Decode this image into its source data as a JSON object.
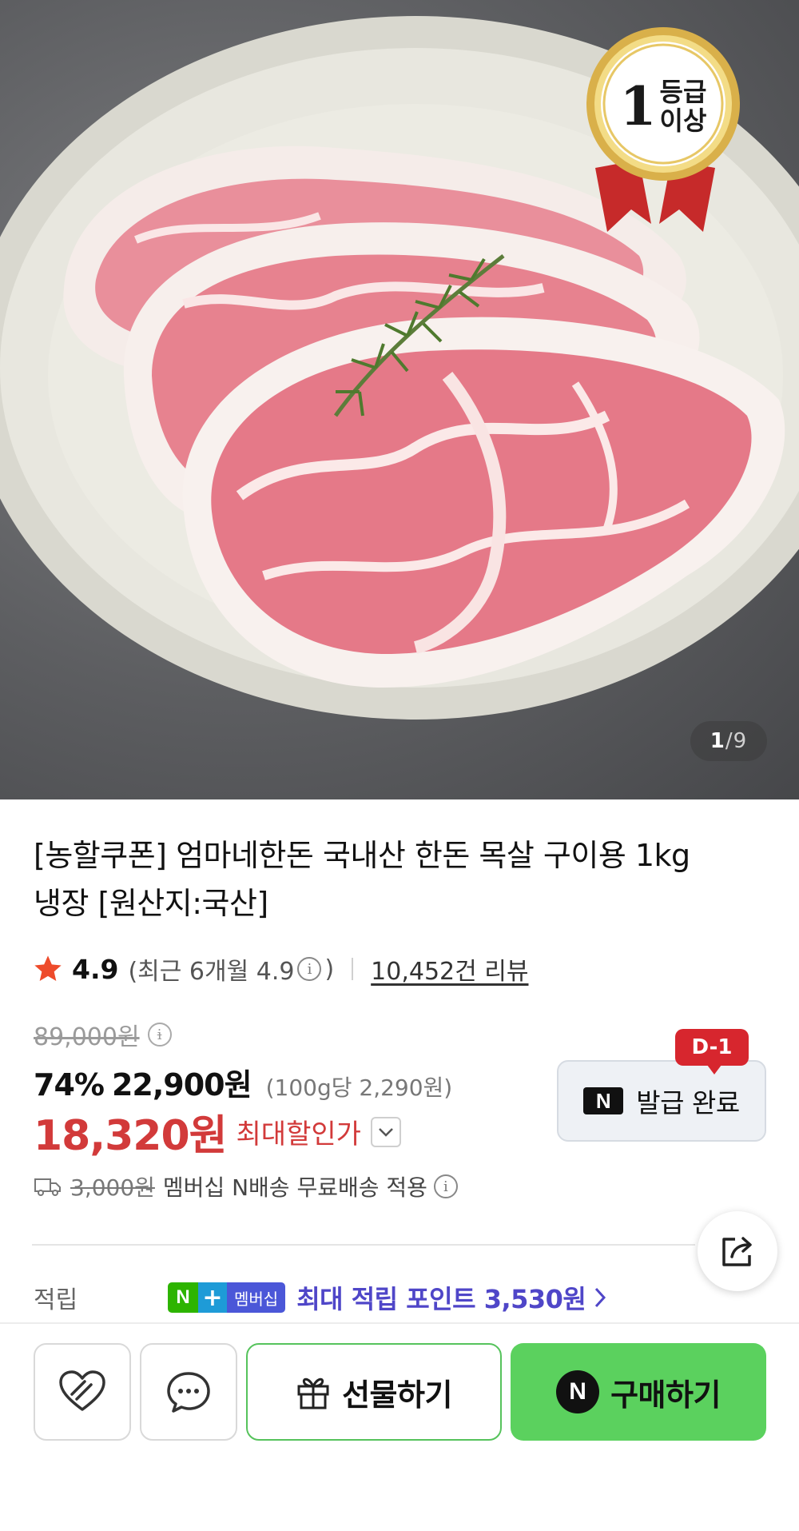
{
  "hero": {
    "badge_line1": "등급",
    "badge_digit": "1",
    "badge_line2": "이상",
    "pager_current": "1",
    "pager_sep": "/",
    "pager_total": "9"
  },
  "product": {
    "title_line1": "[농할쿠폰] 엄마네한돈 국내산 한돈 목살 구이용 1kg",
    "title_line2": "냉장 [원산지:국산]"
  },
  "rating": {
    "score": "4.9",
    "recent_open": "(최근 6개월 4.9",
    "recent_close": ")",
    "reviews": "10,452건 리뷰"
  },
  "price": {
    "original": "89,000원",
    "discount_rate": "74%",
    "sale_price": "22,900원",
    "unit_price": "(100g당 2,290원)",
    "best_price": "18,320원",
    "best_label": "최대할인가"
  },
  "coupon": {
    "label": "발급 완료",
    "dday": "D-1",
    "npay_mark": "N"
  },
  "shipping": {
    "old_fee": "3,000원",
    "text": "멤버십 N배송 무료배송 적용"
  },
  "points": {
    "label": "적립",
    "badge_n": "N",
    "badge_plus": "+",
    "badge_member": "멤버십",
    "text": "최대 적립 포인트 3,530원"
  },
  "actions": {
    "gift_label": "선물하기",
    "buy_label": "구매하기",
    "buy_mark": "N"
  },
  "colors": {
    "sale_red": "#d23a3a",
    "buy_green": "#5bd15e",
    "point_purple": "#4f46c8",
    "dday_red": "#d7262e",
    "star": "#ee4b2b"
  }
}
